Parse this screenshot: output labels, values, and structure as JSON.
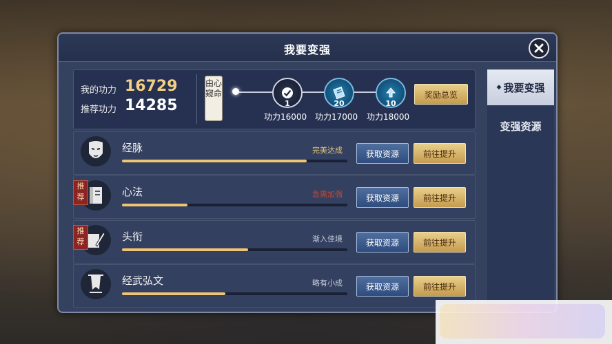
{
  "dialog": {
    "title": "我要变强",
    "close_icon": "close-icon"
  },
  "summary": {
    "my_power_label": "我的功力",
    "my_power_value": "16729",
    "recommended_label": "推荐功力",
    "recommended_value": "14285",
    "seal_text": "由心窥命",
    "milestones": [
      {
        "icon": "check-icon",
        "num": "1",
        "caption": "功力16000",
        "reached": true
      },
      {
        "icon": "scroll-icon",
        "num": "20",
        "caption": "功力17000",
        "reached": false
      },
      {
        "icon": "upgrade-icon",
        "num": "10",
        "caption": "功力18000",
        "reached": false
      }
    ],
    "reward_button": "奖励总览"
  },
  "rows": [
    {
      "name": "经脉",
      "icon": "mask-icon",
      "recommended": false,
      "status": "完美达成",
      "status_color": "#e6c47a",
      "progress": 0.82,
      "get_label": "获取资源",
      "improve_label": "前往提升"
    },
    {
      "name": "心法",
      "icon": "book-icon",
      "recommended": true,
      "tag": "推荐",
      "status": "急需加强",
      "status_color": "#c24a3a",
      "progress": 0.29,
      "get_label": "获取资源",
      "improve_label": "前往提升"
    },
    {
      "name": "头衔",
      "icon": "brush-icon",
      "recommended": true,
      "tag": "推荐",
      "status": "渐入佳境",
      "status_color": "#c6ccdb",
      "progress": 0.56,
      "get_label": "获取资源",
      "improve_label": "前往提升"
    },
    {
      "name": "经武弘文",
      "icon": "banner-icon",
      "recommended": false,
      "status": "略有小成",
      "status_color": "#c6ccdb",
      "progress": 0.46,
      "get_label": "获取资源",
      "improve_label": "前往提升"
    }
  ],
  "tabs": [
    {
      "label": "我要变强",
      "active": true
    },
    {
      "label": "变强资源",
      "active": false
    }
  ],
  "colors": {
    "gold": "#f0c474",
    "panel": "#34415f",
    "accent_blue": "#2f4c7f"
  }
}
